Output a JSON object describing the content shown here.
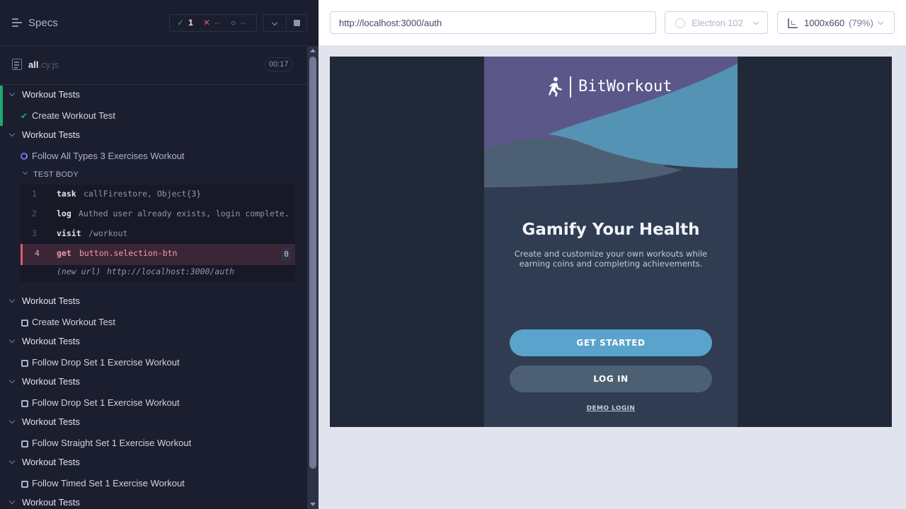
{
  "header": {
    "title": "Specs",
    "stats": {
      "passed": "1",
      "failed": "--",
      "pending": "--"
    }
  },
  "spec_file": {
    "name": "all",
    "extension": ".cy.js",
    "duration": "00:17"
  },
  "suites": [
    {
      "title": "Workout Tests",
      "test": "Create Workout Test",
      "state": "passed"
    },
    {
      "title": "Workout Tests",
      "test": "Follow All Types 3 Exercises Workout",
      "state": "running"
    },
    {
      "title": "Workout Tests",
      "test": "Create Workout Test",
      "state": "pending"
    },
    {
      "title": "Workout Tests",
      "test": "Follow Drop Set 1 Exercise Workout",
      "state": "pending"
    },
    {
      "title": "Workout Tests",
      "test": "Follow Drop Set 1 Exercise Workout",
      "state": "pending"
    },
    {
      "title": "Workout Tests",
      "test": "Follow Straight Set 1 Exercise Workout",
      "state": "pending"
    },
    {
      "title": "Workout Tests",
      "test": "Follow Timed Set 1 Exercise Workout",
      "state": "pending"
    },
    {
      "title": "Workout Tests"
    }
  ],
  "test_body": {
    "label": "TEST BODY",
    "commands": [
      {
        "num": "1",
        "name": "task",
        "message": "callFirestore, Object{3}"
      },
      {
        "num": "2",
        "name": "log",
        "message": "Authed user already exists, login complete."
      },
      {
        "num": "3",
        "name": "visit",
        "message": "/workout"
      },
      {
        "num": "4",
        "name": "get",
        "message": "button.selection-btn",
        "count": "0",
        "state": "failed"
      }
    ],
    "event": {
      "name": "(new url)",
      "message": "http://localhost:3000/auth"
    }
  },
  "browser_bar": {
    "url": "http://localhost:3000/auth",
    "browser": "Electron 102",
    "viewport": "1000x660",
    "scale": "(79%)"
  },
  "app": {
    "logo_text": "BitWorkout",
    "headline": "Gamify Your Health",
    "subtitle": "Create and customize your own workouts while earning coins and completing achievements.",
    "primary_button": "GET STARTED",
    "secondary_button": "LOG IN",
    "demo_link": "DEMO LOGIN",
    "colors": {
      "purple": "#5c5789",
      "teal": "#5593b4",
      "button": "#5aa3cc"
    }
  },
  "colors": {
    "pass": "#1fa971",
    "fail": "#e45770",
    "running": "#6470f3",
    "panel_bg": "#1b1e2e"
  }
}
